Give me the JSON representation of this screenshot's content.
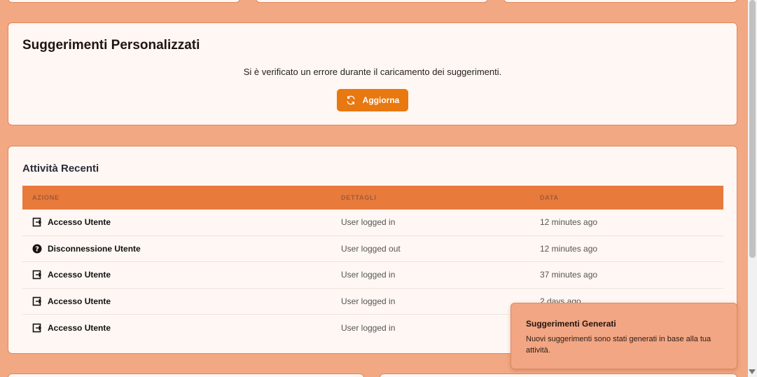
{
  "suggestions": {
    "title": "Suggerimenti Personalizzati",
    "error_message": "Si è verificato un errore durante il caricamento dei suggerimenti.",
    "refresh_label": "Aggiorna",
    "refresh_icon": "refresh-icon"
  },
  "activity": {
    "title": "Attività Recenti",
    "columns": [
      "AZIONE",
      "DETTAGLI",
      "DATA"
    ],
    "rows": [
      {
        "icon": "login-icon",
        "action": "Accesso Utente",
        "details": "User logged in",
        "date": "12 minutes ago"
      },
      {
        "icon": "question-icon",
        "action": "Disconnessione Utente",
        "details": "User logged out",
        "date": "12 minutes ago"
      },
      {
        "icon": "login-icon",
        "action": "Accesso Utente",
        "details": "User logged in",
        "date": "37 minutes ago"
      },
      {
        "icon": "login-icon",
        "action": "Accesso Utente",
        "details": "User logged in",
        "date": "2 days ago"
      },
      {
        "icon": "login-icon",
        "action": "Accesso Utente",
        "details": "User logged in",
        "date": ""
      }
    ]
  },
  "toast": {
    "title": "Suggerimenti Generati",
    "body": "Nuovi suggerimenti sono stati generati in base alla tua attività."
  },
  "colors": {
    "page_bg": "#f2a883",
    "accent": "#e8780f",
    "table_header": "#e87a3c"
  }
}
